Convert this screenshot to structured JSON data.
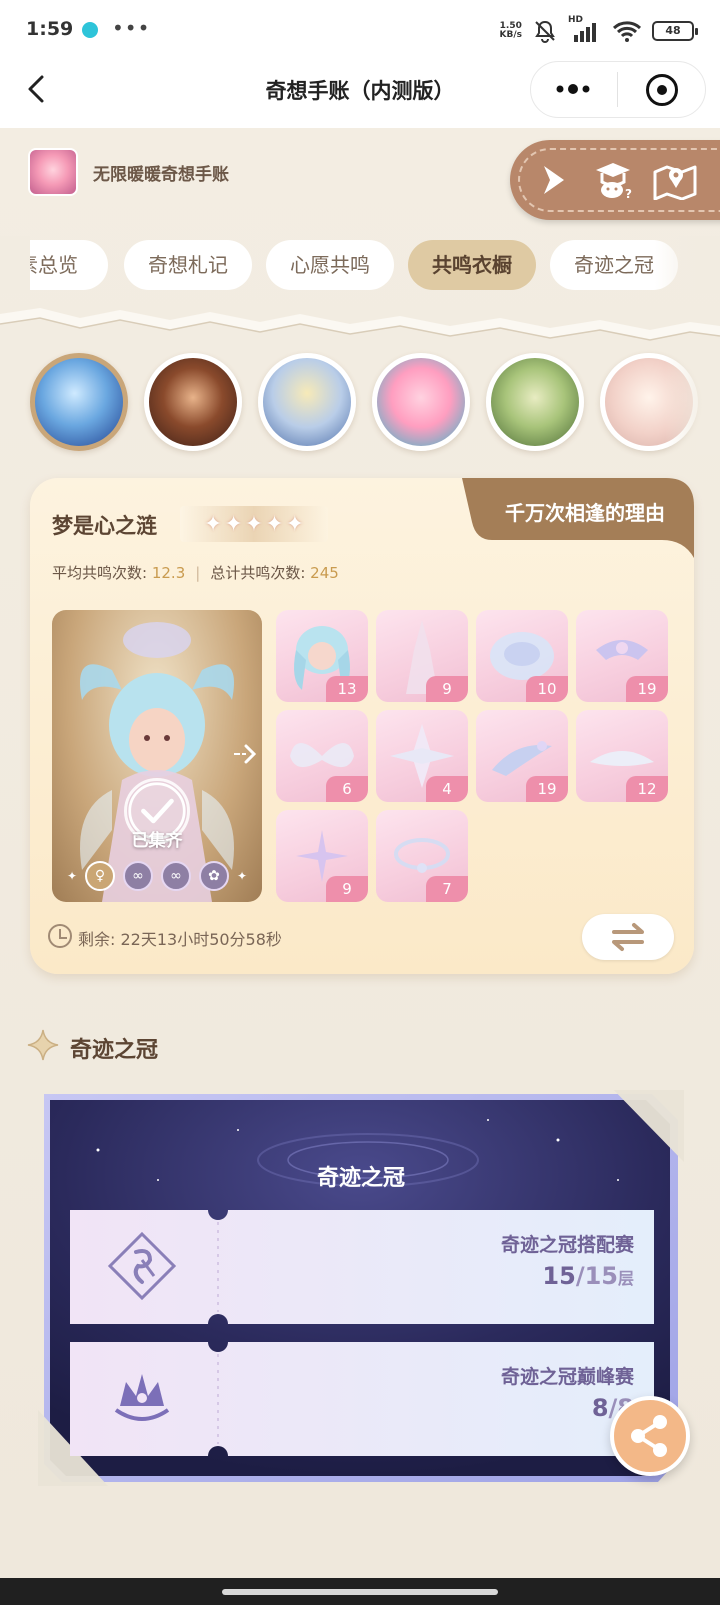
{
  "status_bar": {
    "time": "1:59",
    "more": "•••",
    "net_speed_value": "1.50",
    "net_speed_unit": "KB/s",
    "network_label": "HD",
    "battery": "48"
  },
  "nav": {
    "title": "奇想手账（内测版）"
  },
  "header": {
    "app_name": "无限暖暖奇想手账"
  },
  "tabs": [
    {
      "label": "素总览",
      "active": false
    },
    {
      "label": "奇想札记",
      "active": false
    },
    {
      "label": "心愿共鸣",
      "active": false
    },
    {
      "label": "共鸣衣橱",
      "active": true
    },
    {
      "label": "奇迹之冠",
      "active": false
    }
  ],
  "avatars": [
    {
      "icon": "character-portrait-ice-blue",
      "selected": true
    },
    {
      "icon": "character-portrait-witch-hat",
      "selected": false
    },
    {
      "icon": "character-portrait-blonde-white-dress",
      "selected": false
    },
    {
      "icon": "character-portrait-pink-hair",
      "selected": false
    },
    {
      "icon": "character-portrait-green-dress",
      "selected": false
    },
    {
      "icon": "character-portrait-pink-gown",
      "selected": false
    }
  ],
  "outfit_card": {
    "tag": "千万次相逢的理由",
    "name": "梦是心之涟",
    "stars": 5,
    "avg_label": "平均共鸣次数:",
    "avg_value": "12.3",
    "total_label": "总计共鸣次数:",
    "total_value": "245",
    "collected_label": "已集齐",
    "timer_text": "剩余: 22天13小时50分58秒",
    "pieces": [
      {
        "count": "13"
      },
      {
        "count": "9"
      },
      {
        "count": "10"
      },
      {
        "count": "19"
      },
      {
        "count": "6"
      },
      {
        "count": "4"
      },
      {
        "count": "19"
      },
      {
        "count": "12"
      },
      {
        "count": "9"
      },
      {
        "count": "7"
      }
    ]
  },
  "miracle_section": {
    "title": "奇迹之冠",
    "panel_title": "奇迹之冠",
    "tickets": [
      {
        "name": "奇迹之冠搭配赛",
        "value": "15",
        "max": "/15",
        "unit": "层"
      },
      {
        "name": "奇迹之冠巅峰赛",
        "value": "8",
        "max": "/8",
        "unit": ""
      }
    ]
  },
  "colors": {
    "accent_tab": "#dfcaa3",
    "tool_strip": "#b8876a",
    "piece_badge": "#ee8fab",
    "stat_value": "#c99b4f",
    "panel_purple": "#2b2a5c",
    "share_button": "#f3b888"
  }
}
